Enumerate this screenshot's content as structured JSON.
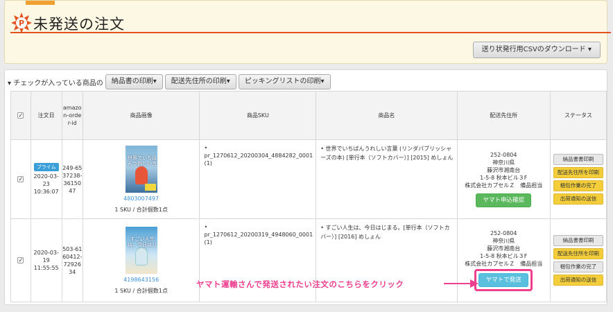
{
  "header": {
    "title": "未発送の注文",
    "csv_button": "送り状発行用CSVのダウンロード ▾"
  },
  "toolbar": {
    "label": "▾ チェックが入っている商品の",
    "buttons": [
      "納品書の印刷▾",
      "配送先住所の印刷▾",
      "ピッキングリストの印刷▾"
    ]
  },
  "table": {
    "headers": {
      "date": "注文日",
      "order_id": "amazon-order-id",
      "image": "商品画像",
      "sku": "商品SKU",
      "name": "商品名",
      "address": "配送先住所",
      "status": "ステータス"
    },
    "rows": [
      {
        "prime": "プライム",
        "date": "2020-03-23 10:36:07",
        "order_id": "249-6537238-3615047",
        "book_title": "世界でいちばんうれしい言葉",
        "isbn": "4803007497",
        "sku_count": "1 SKU / 合計個数1点",
        "sku": "pr_1270612_20200304_4884282_0001 (1)",
        "name": "世界でいちばんうれしい言葉 (リンダパブリッシャーズの本) [単行本（ソフトカバー）] [2015] めしょん",
        "address": [
          "252-0804",
          "神奈川県",
          "藤沢市湘南台",
          "1-5-8 秋本ビル３F",
          "株式会社カプセルＺ　備品担当"
        ],
        "yamato": "ヤマト申込確認",
        "status_buttons": [
          "納品書書印刷",
          "配送先住所を印刷",
          "梱包作業の完了",
          "出荷通知の送信"
        ]
      },
      {
        "prime": "",
        "date": "2020-03-19 11:55:55",
        "order_id": "503-6160412-7292634",
        "book_title": "すごい人生は、今日はじまる",
        "isbn": "4198643156",
        "sku_count": "1 SKU / 合計個数1点",
        "sku": "pr_1270612_20200319_4948060_0001 (1)",
        "name": "すごい人生は、今日はじまる。[単行本（ソフトカバー）] [2016] めしょん",
        "address": [
          "252-0804",
          "神奈川県",
          "藤沢市湘南台",
          "1-5-8 秋本ビル３F",
          "株式会社カプセルＺ　備品担当"
        ],
        "yamato": "ヤマトで発送",
        "status_buttons": [
          "納品書書印刷",
          "配送先住所を印刷",
          "梱包作業の完了",
          "出荷通知の送信"
        ]
      }
    ]
  },
  "callout": "ヤマト運輸さんで発送されたい注文のこちらをクリック",
  "colors": {
    "accent": "#e4501e",
    "callout": "#ee3f8f",
    "yamato_confirm": "#5cb85c",
    "yamato_ship": "#5bc0de",
    "status_yellow": "#f3ce3a"
  }
}
